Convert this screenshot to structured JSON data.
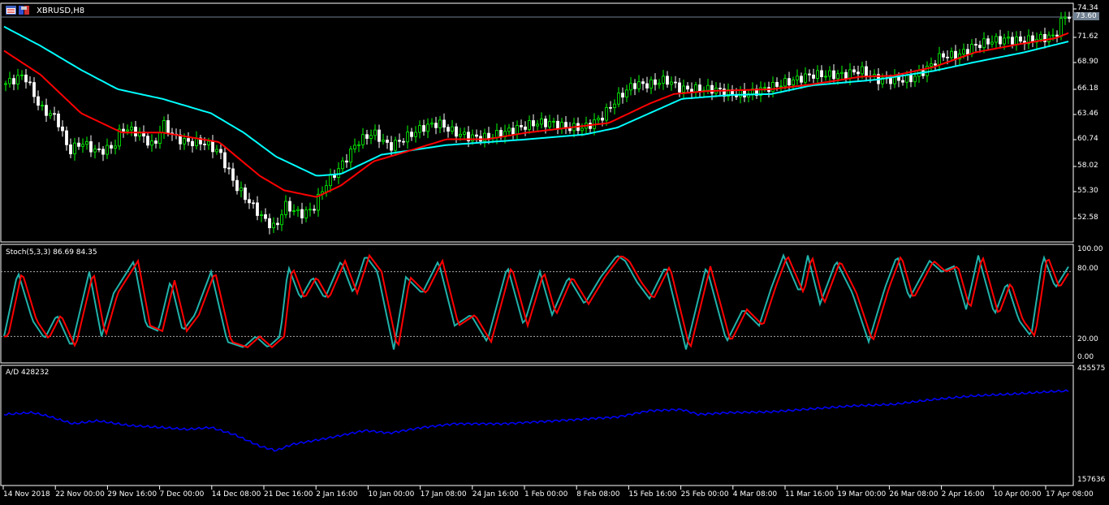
{
  "window": {
    "symbol": "XBRUSD,H8"
  },
  "colors": {
    "bull": "#00ff00",
    "bear": "#ffffff",
    "ma_fast": "#ff0000",
    "ma_slow": "#00ffff",
    "stoch_main": "#20b2aa",
    "stoch_signal": "#ff0000",
    "ad": "#0000ff"
  },
  "price_axis": {
    "ticks": [
      "74.34",
      "71.62",
      "68.90",
      "66.18",
      "63.46",
      "60.74",
      "58.02",
      "55.30",
      "52.58"
    ],
    "current": "73.60"
  },
  "stoch": {
    "label": "Stoch(5,3,3) 86.69 84.35",
    "ticks": [
      "100.00",
      "80.00",
      "20.00",
      "0.00"
    ],
    "levels": [
      80,
      20
    ]
  },
  "ad": {
    "label": "A/D 428232",
    "ticks": [
      "455575",
      "157636"
    ]
  },
  "time_axis": [
    "14 Nov 2018",
    "22 Nov 00:00",
    "29 Nov 16:00",
    "7 Dec 00:00",
    "14 Dec 08:00",
    "21 Dec 16:00",
    "2 Jan 16:00",
    "10 Jan 00:00",
    "17 Jan 08:00",
    "24 Jan 16:00",
    "1 Feb 00:00",
    "8 Feb 08:00",
    "15 Feb 16:00",
    "25 Feb 00:00",
    "4 Mar 08:00",
    "11 Mar 16:00",
    "19 Mar 00:00",
    "26 Mar 08:00",
    "2 Apr 16:00",
    "10 Apr 00:00",
    "17 Apr 08:00"
  ],
  "chart_data": {
    "type": "line",
    "price_range": [
      51.5,
      74.34
    ],
    "bar_index_range": [
      0,
      1320
    ],
    "close": [
      [
        5,
        66.5
      ],
      [
        30,
        67.5
      ],
      [
        50,
        64
      ],
      [
        70,
        63
      ],
      [
        85,
        59.5
      ],
      [
        100,
        60.5
      ],
      [
        120,
        59.5
      ],
      [
        140,
        60
      ],
      [
        150,
        62
      ],
      [
        170,
        61.5
      ],
      [
        190,
        60
      ],
      [
        200,
        62.5
      ],
      [
        215,
        61
      ],
      [
        230,
        60.5
      ],
      [
        250,
        60.5
      ],
      [
        270,
        59.5
      ],
      [
        290,
        56
      ],
      [
        310,
        54
      ],
      [
        325,
        52.5
      ],
      [
        340,
        51.5
      ],
      [
        350,
        54
      ],
      [
        370,
        53
      ],
      [
        385,
        53.5
      ],
      [
        400,
        56
      ],
      [
        420,
        58
      ],
      [
        440,
        60.5
      ],
      [
        460,
        61.5
      ],
      [
        480,
        60
      ],
      [
        500,
        61
      ],
      [
        520,
        62
      ],
      [
        540,
        62.5
      ],
      [
        560,
        61.5
      ],
      [
        580,
        61
      ],
      [
        600,
        61
      ],
      [
        620,
        61.5
      ],
      [
        640,
        62
      ],
      [
        660,
        62.5
      ],
      [
        680,
        62.5
      ],
      [
        700,
        62
      ],
      [
        720,
        62
      ],
      [
        740,
        63
      ],
      [
        760,
        65
      ],
      [
        780,
        66.5
      ],
      [
        800,
        66.5
      ],
      [
        820,
        67
      ],
      [
        840,
        66
      ],
      [
        860,
        66
      ],
      [
        880,
        66
      ],
      [
        900,
        65.5
      ],
      [
        920,
        65.5
      ],
      [
        940,
        66
      ],
      [
        960,
        66.5
      ],
      [
        980,
        67
      ],
      [
        1000,
        67.5
      ],
      [
        1020,
        67.5
      ],
      [
        1040,
        67.5
      ],
      [
        1060,
        68
      ],
      [
        1080,
        67
      ],
      [
        1100,
        67
      ],
      [
        1120,
        67
      ],
      [
        1140,
        68
      ],
      [
        1160,
        69.5
      ],
      [
        1180,
        69.5
      ],
      [
        1200,
        70.5
      ],
      [
        1220,
        71
      ],
      [
        1240,
        71.2
      ],
      [
        1260,
        71
      ],
      [
        1280,
        71.3
      ],
      [
        1300,
        71.5
      ],
      [
        1310,
        73.6
      ],
      [
        1318,
        73.6
      ]
    ],
    "ma_fast": [
      [
        5,
        70
      ],
      [
        50,
        67.5
      ],
      [
        100,
        63.5
      ],
      [
        150,
        61.5
      ],
      [
        200,
        61.5
      ],
      [
        270,
        60.5
      ],
      [
        320,
        57
      ],
      [
        350,
        55.5
      ],
      [
        390,
        54.8
      ],
      [
        420,
        56
      ],
      [
        460,
        58.5
      ],
      [
        500,
        59.5
      ],
      [
        550,
        60.8
      ],
      [
        600,
        60.8
      ],
      [
        650,
        61.5
      ],
      [
        700,
        62
      ],
      [
        750,
        62.5
      ],
      [
        800,
        64.5
      ],
      [
        830,
        65.5
      ],
      [
        870,
        65.8
      ],
      [
        950,
        66
      ],
      [
        1000,
        66.5
      ],
      [
        1060,
        67.3
      ],
      [
        1100,
        67.4
      ],
      [
        1150,
        68.3
      ],
      [
        1200,
        69.8
      ],
      [
        1250,
        70.6
      ],
      [
        1300,
        71.3
      ],
      [
        1318,
        71.9
      ]
    ],
    "ma_slow": [
      [
        5,
        72.5
      ],
      [
        50,
        70.5
      ],
      [
        100,
        68
      ],
      [
        145,
        66
      ],
      [
        200,
        65
      ],
      [
        260,
        63.5
      ],
      [
        300,
        61.5
      ],
      [
        340,
        59
      ],
      [
        390,
        57
      ],
      [
        420,
        57.2
      ],
      [
        470,
        59.2
      ],
      [
        550,
        60.2
      ],
      [
        650,
        60.8
      ],
      [
        720,
        61.3
      ],
      [
        760,
        62
      ],
      [
        800,
        63.5
      ],
      [
        840,
        65
      ],
      [
        900,
        65.4
      ],
      [
        950,
        65.5
      ],
      [
        1000,
        66.4
      ],
      [
        1080,
        67
      ],
      [
        1150,
        67.9
      ],
      [
        1200,
        68.8
      ],
      [
        1260,
        69.8
      ],
      [
        1318,
        71
      ]
    ],
    "stoch_main": [
      [
        5,
        20
      ],
      [
        22,
        80
      ],
      [
        40,
        35
      ],
      [
        55,
        18
      ],
      [
        70,
        40
      ],
      [
        88,
        10
      ],
      [
        110,
        80
      ],
      [
        125,
        20
      ],
      [
        140,
        60
      ],
      [
        165,
        90
      ],
      [
        180,
        30
      ],
      [
        195,
        25
      ],
      [
        210,
        72
      ],
      [
        225,
        25
      ],
      [
        240,
        40
      ],
      [
        260,
        80
      ],
      [
        280,
        15
      ],
      [
        300,
        10
      ],
      [
        315,
        20
      ],
      [
        330,
        10
      ],
      [
        345,
        20
      ],
      [
        355,
        85
      ],
      [
        370,
        55
      ],
      [
        385,
        75
      ],
      [
        400,
        55
      ],
      [
        420,
        90
      ],
      [
        435,
        60
      ],
      [
        450,
        95
      ],
      [
        465,
        80
      ],
      [
        485,
        8
      ],
      [
        500,
        75
      ],
      [
        520,
        60
      ],
      [
        540,
        90
      ],
      [
        560,
        30
      ],
      [
        580,
        40
      ],
      [
        600,
        15
      ],
      [
        625,
        85
      ],
      [
        645,
        30
      ],
      [
        665,
        80
      ],
      [
        680,
        40
      ],
      [
        700,
        75
      ],
      [
        720,
        50
      ],
      [
        740,
        75
      ],
      [
        760,
        95
      ],
      [
        770,
        90
      ],
      [
        785,
        70
      ],
      [
        800,
        55
      ],
      [
        820,
        85
      ],
      [
        845,
        8
      ],
      [
        870,
        85
      ],
      [
        895,
        15
      ],
      [
        915,
        45
      ],
      [
        935,
        30
      ],
      [
        950,
        65
      ],
      [
        965,
        95
      ],
      [
        985,
        60
      ],
      [
        995,
        95
      ],
      [
        1010,
        50
      ],
      [
        1030,
        90
      ],
      [
        1050,
        60
      ],
      [
        1070,
        15
      ],
      [
        1090,
        65
      ],
      [
        1105,
        95
      ],
      [
        1120,
        55
      ],
      [
        1145,
        90
      ],
      [
        1160,
        80
      ],
      [
        1175,
        85
      ],
      [
        1190,
        45
      ],
      [
        1205,
        95
      ],
      [
        1225,
        40
      ],
      [
        1240,
        70
      ],
      [
        1255,
        35
      ],
      [
        1270,
        20
      ],
      [
        1285,
        95
      ],
      [
        1300,
        65
      ],
      [
        1318,
        87
      ]
    ],
    "ad": [
      [
        5,
        335000
      ],
      [
        40,
        340000
      ],
      [
        60,
        330000
      ],
      [
        90,
        310000
      ],
      [
        120,
        318000
      ],
      [
        160,
        305000
      ],
      [
        200,
        300000
      ],
      [
        230,
        295000
      ],
      [
        260,
        300000
      ],
      [
        290,
        280000
      ],
      [
        320,
        250000
      ],
      [
        340,
        238000
      ],
      [
        360,
        255000
      ],
      [
        400,
        270000
      ],
      [
        450,
        292000
      ],
      [
        480,
        285000
      ],
      [
        520,
        300000
      ],
      [
        560,
        310000
      ],
      [
        620,
        310000
      ],
      [
        700,
        320000
      ],
      [
        760,
        328000
      ],
      [
        800,
        345000
      ],
      [
        840,
        348000
      ],
      [
        860,
        335000
      ],
      [
        900,
        340000
      ],
      [
        950,
        342000
      ],
      [
        1000,
        350000
      ],
      [
        1050,
        358000
      ],
      [
        1100,
        362000
      ],
      [
        1150,
        375000
      ],
      [
        1200,
        385000
      ],
      [
        1250,
        390000
      ],
      [
        1300,
        397000
      ],
      [
        1318,
        398000
      ]
    ],
    "ad_range": [
      157636,
      455575
    ]
  }
}
